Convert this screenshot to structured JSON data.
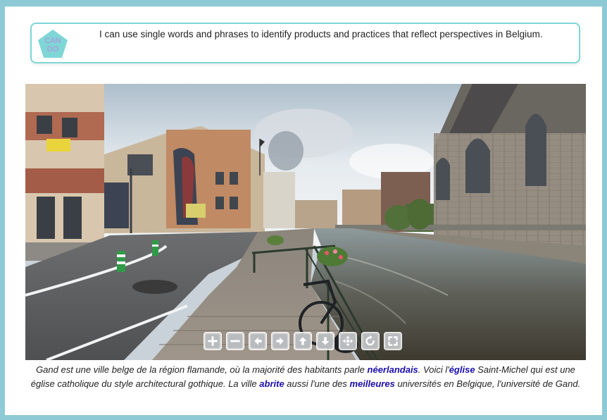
{
  "cando": {
    "badge_text": "CAN DO",
    "badge_line1": "CAN",
    "badge_line2": "DO",
    "statement": "I can use single words and phrases to identify products and practices that reflect perspectives in Belgium."
  },
  "panorama": {
    "sign_text": "",
    "controls": [
      {
        "name": "zoom-in",
        "label": "+"
      },
      {
        "name": "zoom-out",
        "label": "−"
      },
      {
        "name": "pan-left",
        "label": "◀"
      },
      {
        "name": "pan-right",
        "label": "▶"
      },
      {
        "name": "pan-up",
        "label": "▲"
      },
      {
        "name": "pan-down",
        "label": "▼"
      },
      {
        "name": "move",
        "label": "✥"
      },
      {
        "name": "rotate",
        "label": "↻"
      },
      {
        "name": "fullscreen",
        "label": "⛶"
      }
    ]
  },
  "caption": {
    "p1": "Gand est une ville belge de la région flamande, où la majorité des habitants parle ",
    "k1": "néerlandais",
    "p2": ". Voici l'",
    "k2": "église",
    "p3": " Saint-Michel qui est une église catholique du style architectural gothique. La ville ",
    "k3": "abrite",
    "p4": " aussi l'une des ",
    "k4": "meilleures",
    "p5": " universités en Belgique, l'université de Gand."
  },
  "colors": {
    "frame": "#8ec9d6",
    "cando_border": "#7fd6d6",
    "badge": "#7fd6d6",
    "badge_text": "#b58be0",
    "keyword": "#1a0dab"
  }
}
